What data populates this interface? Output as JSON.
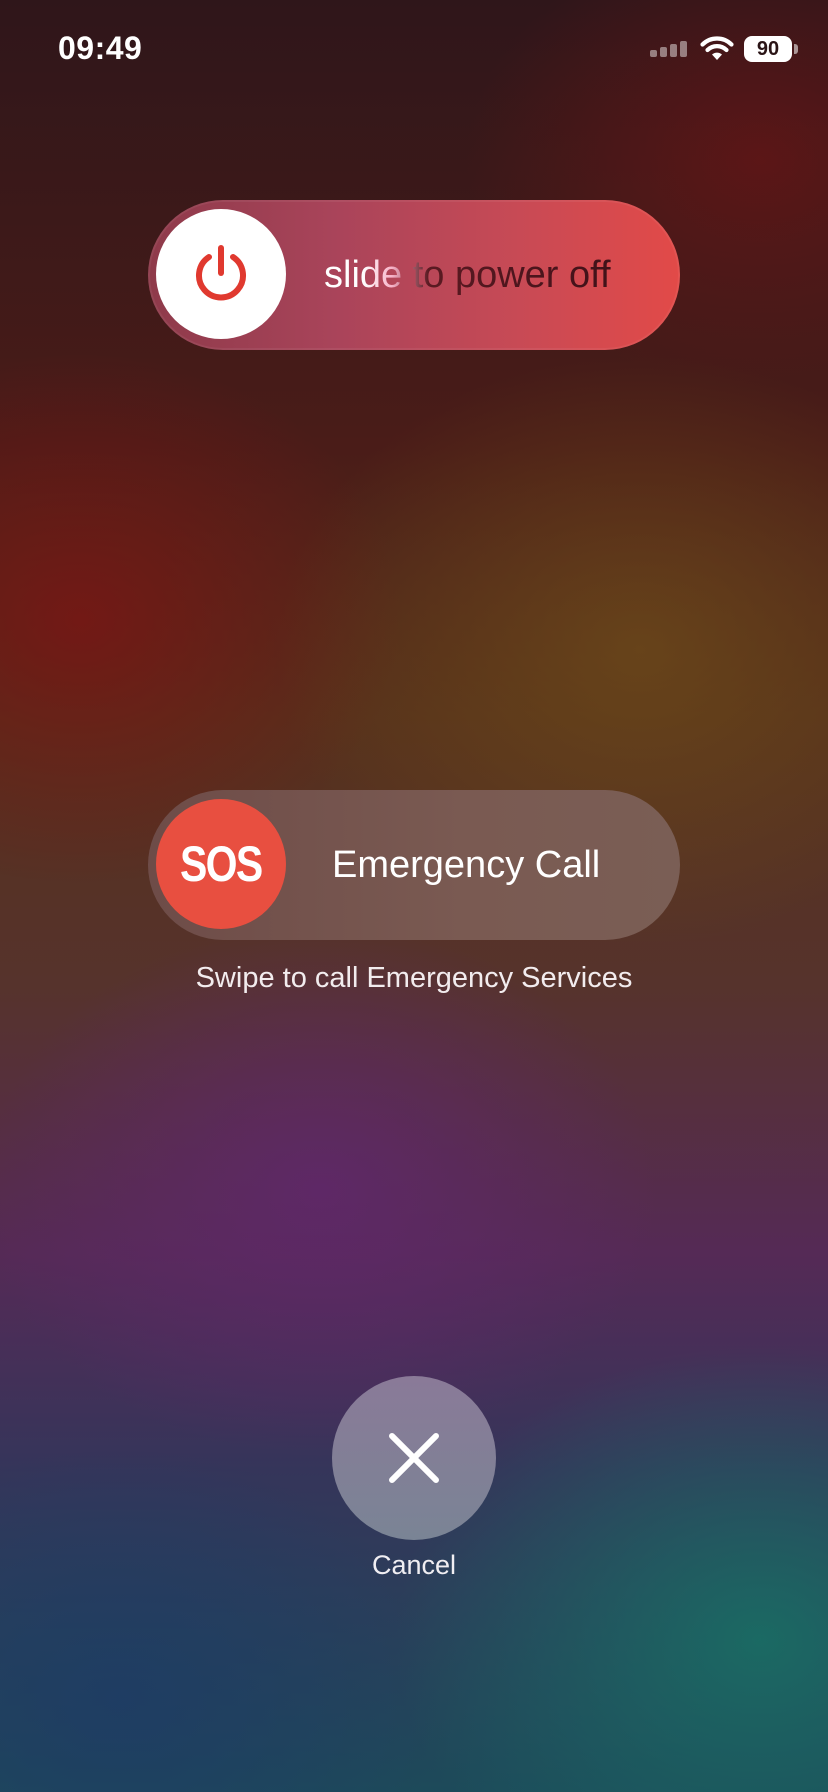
{
  "status_bar": {
    "time": "09:49",
    "battery_level": "90",
    "icons": [
      "signal-icon",
      "wifi-icon",
      "battery-icon"
    ]
  },
  "power_slider": {
    "label": "slide to power off",
    "knob_icon": "power-icon",
    "knob_icon_color": "#e0392f"
  },
  "sos_slider": {
    "knob_text": "SOS",
    "label": "Emergency Call",
    "knob_color": "#e84f40"
  },
  "hint": "Swipe to call Emergency Services",
  "cancel": {
    "icon": "close-icon",
    "label": "Cancel"
  }
}
